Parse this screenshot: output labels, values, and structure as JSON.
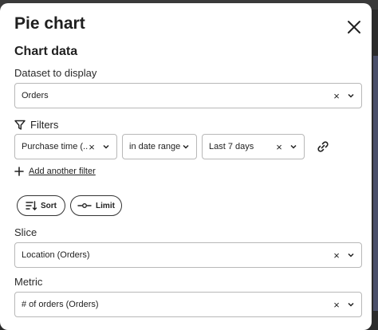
{
  "dialog": {
    "title": "Pie chart",
    "section_title": "Chart data"
  },
  "dataset": {
    "label": "Dataset to display",
    "value": "Orders"
  },
  "filters": {
    "label": "Filters",
    "field": "Purchase time (...",
    "operator": "in date range",
    "value": "Last 7 days",
    "add_label": "Add another filter"
  },
  "buttons": {
    "sort_label": "Sort",
    "limit_label": "Limit"
  },
  "slice": {
    "label": "Slice",
    "value": "Location (Orders)"
  },
  "metric": {
    "label": "Metric",
    "value": "# of orders (Orders)"
  },
  "icons": {
    "close": "close-icon",
    "clear": "x-icon",
    "chevron": "chevron-down-icon",
    "filter": "funnel-icon",
    "link": "link-icon",
    "add": "plus-icon",
    "sort": "sort-icon",
    "limit": "limit-icon"
  }
}
